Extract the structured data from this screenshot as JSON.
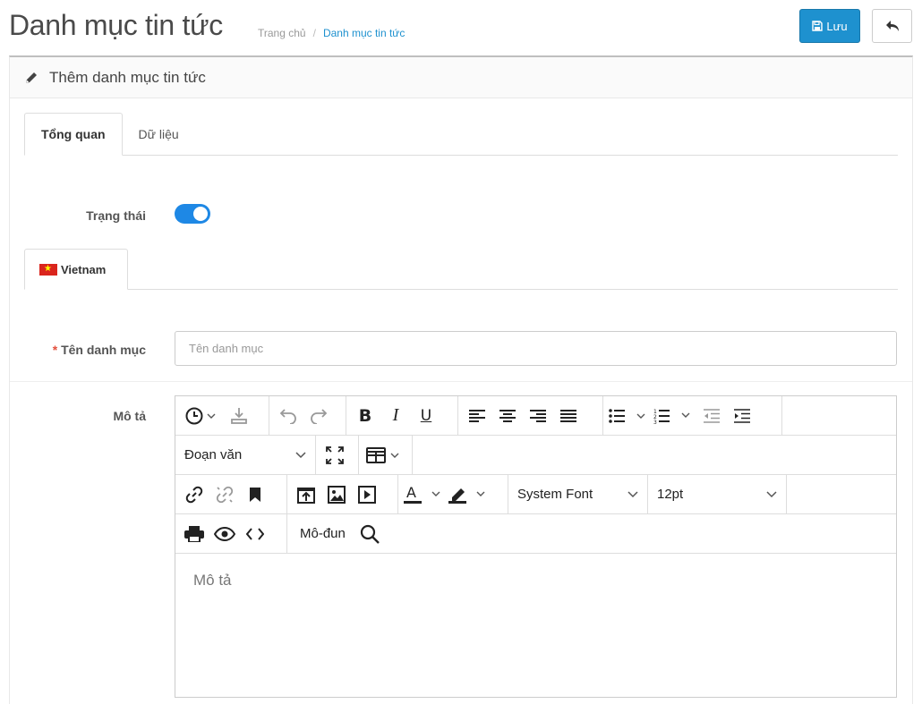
{
  "header": {
    "title": "Danh mục tin tức",
    "breadcrumb": [
      "Trang chủ",
      "Danh mục tin tức"
    ],
    "breadcrumb_sep": "/",
    "save_label": "Lưu"
  },
  "panel": {
    "heading": "Thêm danh mục tin tức"
  },
  "tabs": [
    {
      "label": "Tổng quan",
      "active": true
    },
    {
      "label": "Dữ liệu",
      "active": false
    }
  ],
  "status": {
    "label": "Trạng thái",
    "enabled": true
  },
  "language_tab": {
    "label": "Vietnam"
  },
  "name_field": {
    "required_mark": "*",
    "label": "Tên danh mục",
    "value": "",
    "placeholder": "Tên danh mục"
  },
  "description": {
    "label": "Mô tả",
    "placeholder": "Mô tả"
  },
  "editor_toolbar": {
    "block_format": "Đoạn văn",
    "font_family": "System Font",
    "font_size": "12pt",
    "module_label": "Mô-đun"
  },
  "colors": {
    "primary": "#1e91cf",
    "toggle_on": "#1e88e5",
    "required": "#e3503e"
  }
}
